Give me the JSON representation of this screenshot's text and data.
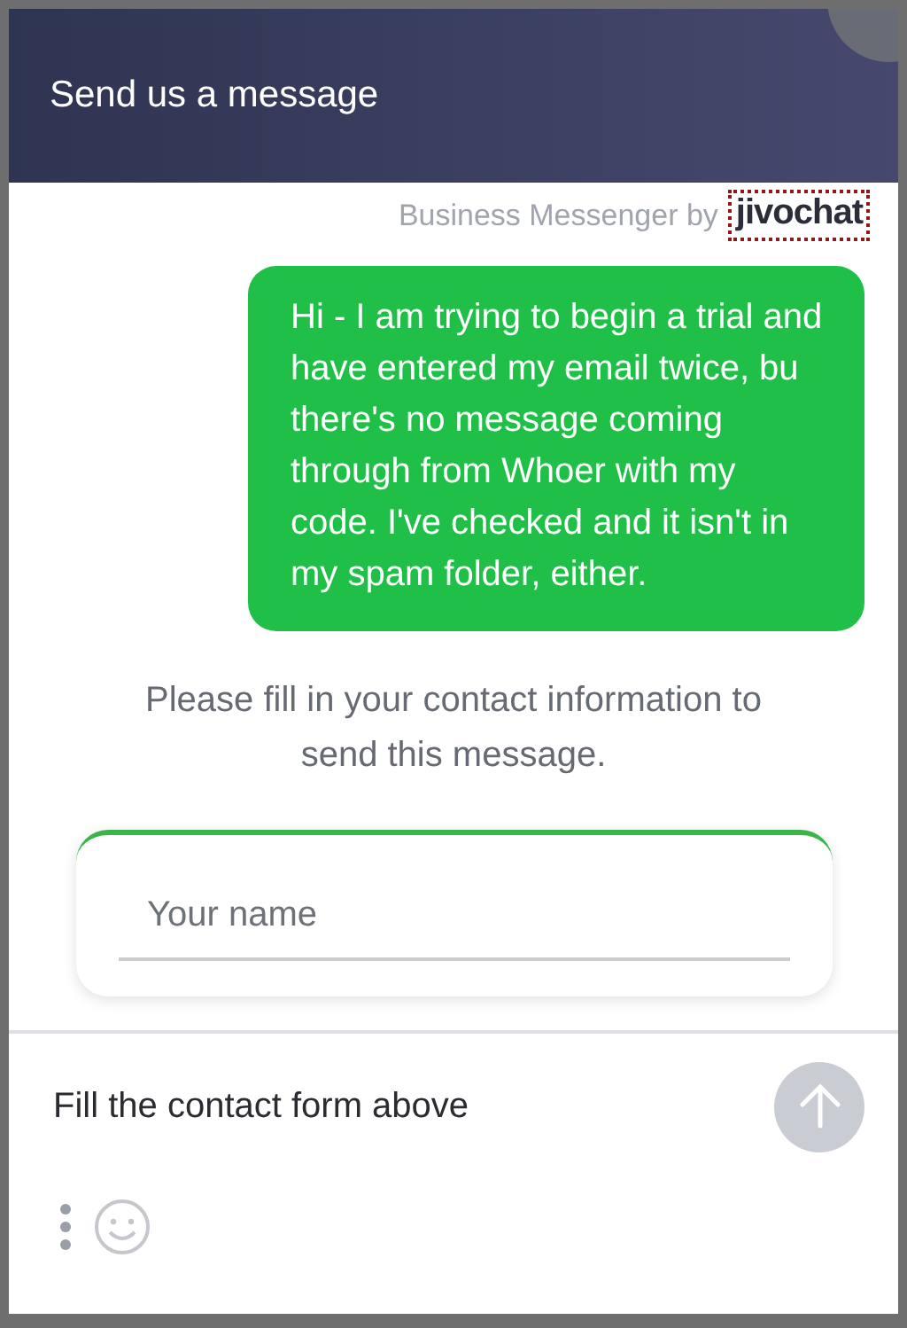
{
  "header": {
    "title": "Send us a message"
  },
  "branding": {
    "label": "Business Messenger by",
    "logo": "jivochat"
  },
  "messages": [
    {
      "kind": "outgoing",
      "text": "Hi - I am trying to begin a trial and have entered my email twice, bu there's no message coming through from Whoer with my code. I've checked and it isn't in my spam folder, either."
    }
  ],
  "notice": "Please fill in your contact information to send this message.",
  "contact_form": {
    "fields": [
      {
        "placeholder": "Your name"
      }
    ]
  },
  "composer": {
    "placeholder": "Fill the contact form above",
    "send_disabled": true
  }
}
